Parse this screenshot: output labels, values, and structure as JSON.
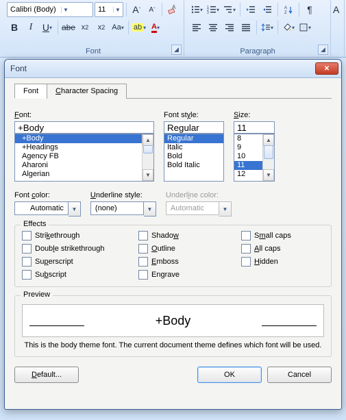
{
  "ribbon": {
    "font_group_label": "Font",
    "para_group_label": "Paragraph",
    "font_name": "Calibri (Body)",
    "font_size": "11",
    "grow_icon": "A",
    "shrink_icon": "A",
    "bold": "B",
    "italic": "I",
    "underline": "U",
    "strike": "abe",
    "subscript": "x",
    "subscript_small": "2",
    "superscript": "x",
    "superscript_small": "2",
    "changecase": "Aa",
    "highlight": "ab",
    "fontcolor": "A"
  },
  "dialog": {
    "title": "Font",
    "tabs": {
      "font": "Font",
      "spacing": "Character Spacing"
    },
    "labels": {
      "font": "Font:",
      "style": "Font style:",
      "size": "Size:",
      "fontcolor": "Font color:",
      "ustyle": "Underline style:",
      "ucolor": "Underline color:",
      "effects": "Effects",
      "preview": "Preview"
    },
    "font_value": "+Body",
    "font_list": [
      "+Body",
      "+Headings",
      "Agency FB",
      "Aharoni",
      "Algerian"
    ],
    "font_selected_index": 0,
    "style_value": "Regular",
    "style_list": [
      "Regular",
      "Italic",
      "Bold",
      "Bold Italic"
    ],
    "style_selected_index": 0,
    "size_value": "11",
    "size_list": [
      "8",
      "9",
      "10",
      "11",
      "12"
    ],
    "size_selected_index": 3,
    "color_value": "Automatic",
    "ustyle_value": "(none)",
    "ucolor_value": "Automatic",
    "effects": {
      "strike": "Strikethrough",
      "dstrike": "Double strikethrough",
      "super": "Superscript",
      "sub": "Subscript",
      "shadow": "Shadow",
      "outline": "Outline",
      "emboss": "Emboss",
      "engrave": "Engrave",
      "smallcaps": "Small caps",
      "allcaps": "All caps",
      "hidden": "Hidden"
    },
    "preview_text": "+Body",
    "note": "This is the body theme font. The current document theme defines which font will be used.",
    "buttons": {
      "default": "Default...",
      "ok": "OK",
      "cancel": "Cancel"
    }
  }
}
